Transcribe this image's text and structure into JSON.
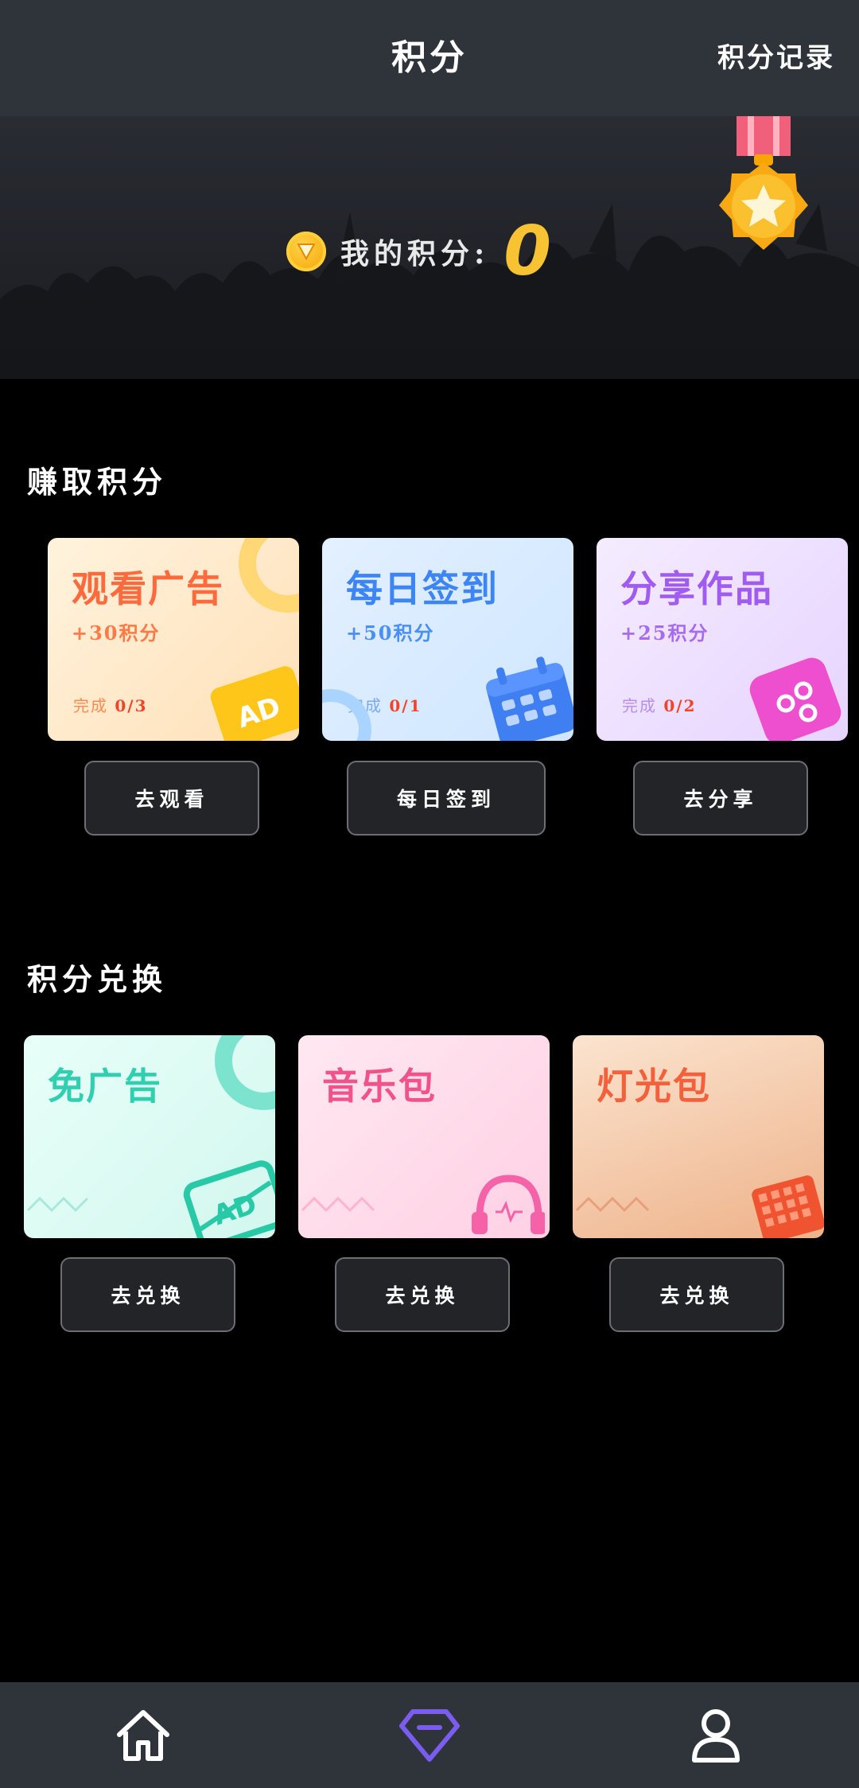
{
  "header": {
    "title": "积分",
    "record_label": "积分记录"
  },
  "banner": {
    "points_label": "我的积分:",
    "points_value": "0"
  },
  "earn": {
    "section_title": "赚取积分",
    "tasks": [
      {
        "title": "观看广告",
        "reward": "+30积分",
        "progress_label": "完成",
        "progress": "0/3",
        "button": "去观看"
      },
      {
        "title": "每日签到",
        "reward": "+50积分",
        "progress_label": "完成",
        "progress": "0/1",
        "button": "每日签到"
      },
      {
        "title": "分享作品",
        "reward": "+25积分",
        "progress_label": "完成",
        "progress": "0/2",
        "button": "去分享"
      }
    ]
  },
  "exchange": {
    "section_title": "积分兑换",
    "items": [
      {
        "title": "免广告",
        "button": "去兑换"
      },
      {
        "title": "音乐包",
        "button": "去兑换"
      },
      {
        "title": "灯光包",
        "button": "去兑换"
      }
    ]
  },
  "tabbar": {
    "items": [
      {
        "icon": "home-icon",
        "active": false
      },
      {
        "icon": "diamond-icon",
        "active": true
      },
      {
        "icon": "user-icon",
        "active": false
      }
    ],
    "active_color": "#7b5cf0",
    "inactive_color": "#ffffff"
  },
  "colors": {
    "accent_gold": "#f7c332",
    "header_bg": "#2f343b"
  }
}
